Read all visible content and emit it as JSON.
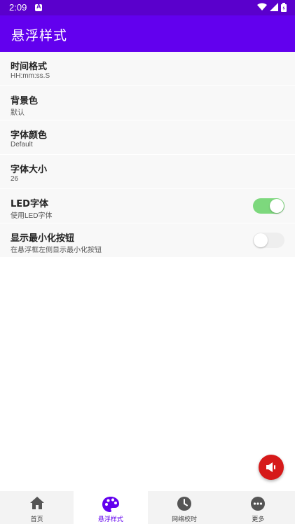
{
  "status_bar": {
    "time": "2:09"
  },
  "app_bar": {
    "title": "悬浮样式"
  },
  "settings": [
    {
      "title": "时间格式",
      "value": "HH:mm:ss.S"
    },
    {
      "title": "背景色",
      "value": "默认"
    },
    {
      "title": "字体颜色",
      "value": "Default"
    },
    {
      "title": "字体大小",
      "value": "26"
    },
    {
      "title": "LED字体",
      "value": "使用LED字体",
      "switch_on": true
    },
    {
      "title": "显示最小化按钮",
      "value": "在悬浮框左侧显示最小化按钮",
      "switch_on": false
    }
  ],
  "fab": {
    "icon": "speaker-icon",
    "color": "#d61a1a"
  },
  "bottom_nav": [
    {
      "label": "首页",
      "icon": "home-icon"
    },
    {
      "label": "悬浮样式",
      "icon": "palette-icon",
      "active": true
    },
    {
      "label": "网络校时",
      "icon": "clock-icon"
    },
    {
      "label": "更多",
      "icon": "more-icon"
    }
  ],
  "colors": {
    "primary": "#6200ee",
    "status_bar": "#5a00cc",
    "switch_on": "#7dd87d"
  }
}
